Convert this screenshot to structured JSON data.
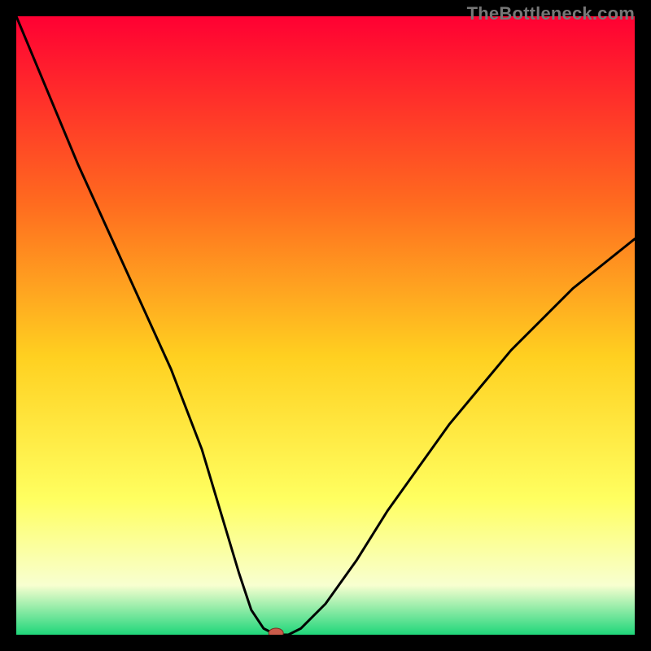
{
  "watermark": "TheBottleneck.com",
  "chart_data": {
    "type": "line",
    "title": "",
    "xlabel": "",
    "ylabel": "",
    "xlim": [
      0,
      100
    ],
    "ylim": [
      0,
      100
    ],
    "x": [
      0,
      5,
      10,
      15,
      20,
      25,
      30,
      33,
      36,
      38,
      40,
      42,
      44,
      46,
      50,
      55,
      60,
      65,
      70,
      75,
      80,
      85,
      90,
      95,
      100
    ],
    "values": [
      100,
      88,
      76,
      65,
      54,
      43,
      30,
      20,
      10,
      4,
      1,
      0,
      0,
      1,
      5,
      12,
      20,
      27,
      34,
      40,
      46,
      51,
      56,
      60,
      64
    ],
    "notes": "Curve plunges from top-left to a flat zero around x≈42–44, then rises again to ~64% at right edge. Background is a vertical rainbow gradient (red → orange → yellow → green) inside a black frame. A small red/orange dot marks the minimum."
  },
  "colors": {
    "frame": "#000000",
    "curve": "#000000",
    "dot_fill": "#c95b4a",
    "dot_stroke": "#7a2e22",
    "gradient_top": "#ff0033",
    "gradient_mid1": "#ff6a1f",
    "gradient_mid2": "#ffd020",
    "gradient_mid3": "#ffff60",
    "gradient_mid4": "#f8ffd0",
    "gradient_bottom": "#1fd67a"
  }
}
